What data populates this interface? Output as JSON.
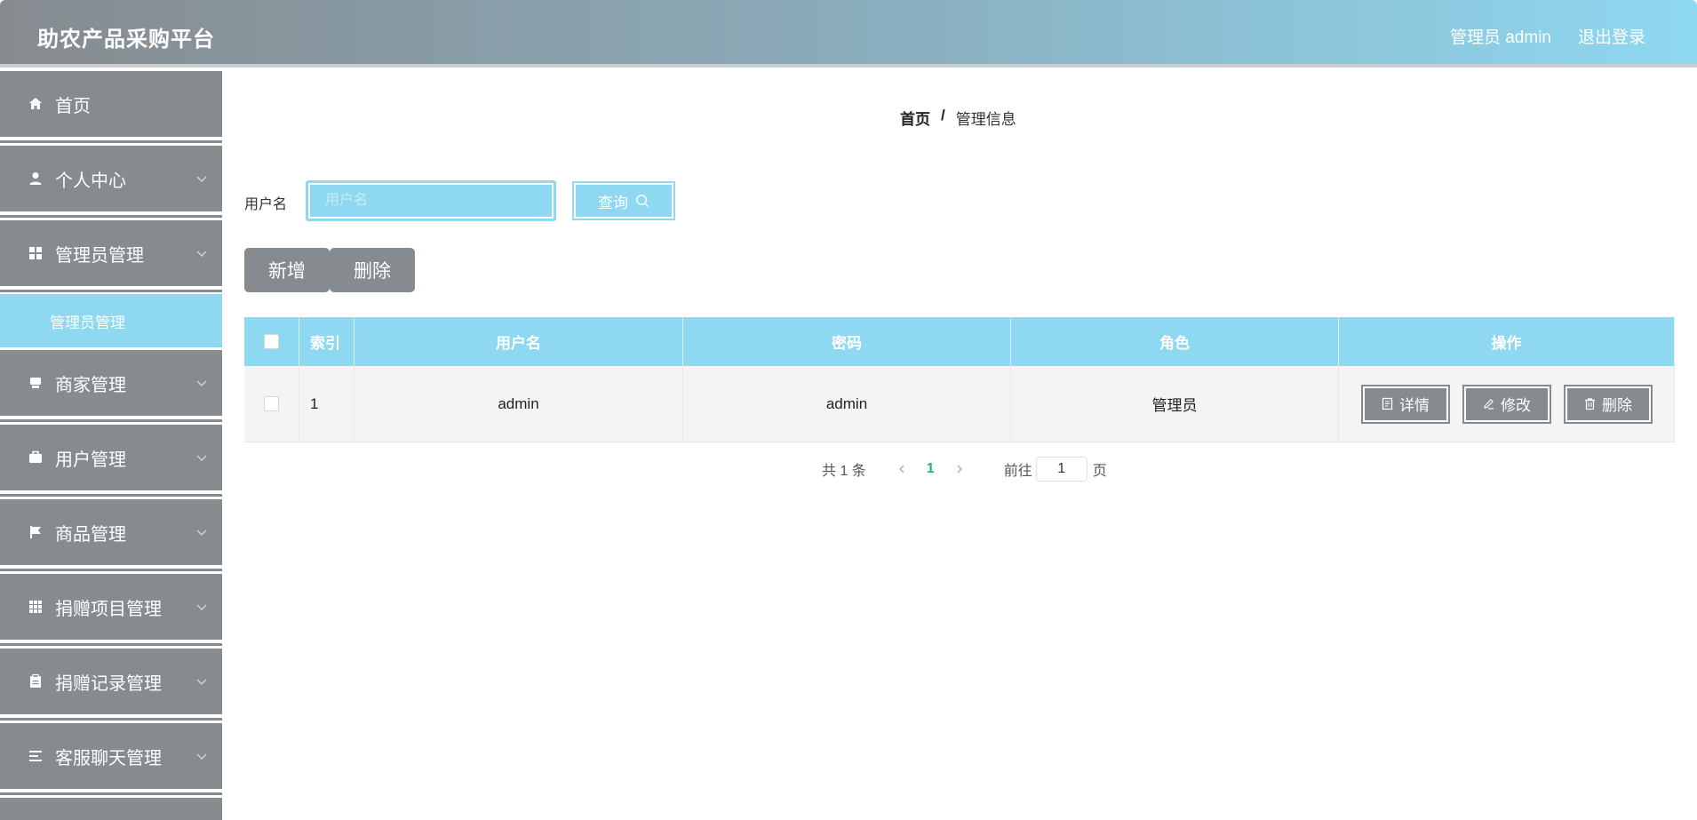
{
  "header": {
    "title": "助农产品采购平台",
    "user_label": "管理员 admin",
    "logout_label": "退出登录"
  },
  "sidebar": {
    "items": [
      {
        "label": "首页",
        "icon": "home-icon"
      },
      {
        "label": "个人中心",
        "icon": "user-icon"
      },
      {
        "label": "管理员管理",
        "icon": "grid-icon"
      },
      {
        "label": "商家管理",
        "icon": "shop-icon"
      },
      {
        "label": "用户管理",
        "icon": "briefcase-icon"
      },
      {
        "label": "商品管理",
        "icon": "flag-icon"
      },
      {
        "label": "捐赠项目管理",
        "icon": "apps-icon"
      },
      {
        "label": "捐赠记录管理",
        "icon": "clipboard-icon"
      },
      {
        "label": "客服聊天管理",
        "icon": "list-icon"
      }
    ],
    "active_sub_item": "管理员管理"
  },
  "breadcrumb": {
    "home": "首页",
    "separator": "/",
    "current": "管理信息"
  },
  "search": {
    "label": "用户名",
    "placeholder": "用户名",
    "button_label": "查询"
  },
  "actions": {
    "add_label": "新增",
    "delete_label": "删除"
  },
  "table": {
    "columns": [
      "索引",
      "用户名",
      "密码",
      "角色",
      "操作"
    ],
    "rows": [
      {
        "index": "1",
        "username": "admin",
        "password": "admin",
        "role": "管理员"
      }
    ],
    "row_actions": {
      "detail": "详情",
      "edit": "修改",
      "delete": "删除"
    }
  },
  "pagination": {
    "total": "共 1 条",
    "current_page": "1",
    "goto_label": "前往",
    "goto_value": "1",
    "unit": "页"
  },
  "colors": {
    "primary_gray": "#868b8f",
    "accent_blue": "#8ed8f1",
    "active_page": "#1fb868"
  }
}
